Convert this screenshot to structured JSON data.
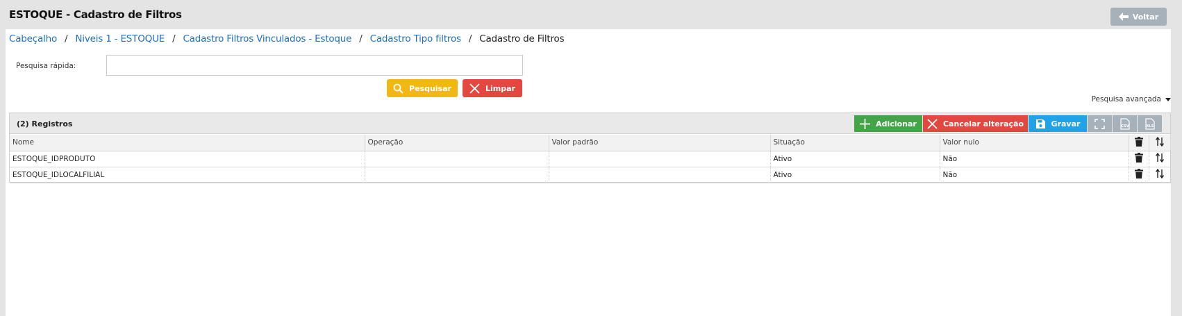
{
  "header": {
    "title": "ESTOQUE - Cadastro de Filtros",
    "back_label": "Voltar"
  },
  "breadcrumb": {
    "items": [
      "Cabeçalho",
      "Niveis 1 - ESTOQUE",
      "Cadastro Filtros Vinculados - Estoque",
      "Cadastro Tipo filtros"
    ],
    "current": "Cadastro de Filtros"
  },
  "search": {
    "label": "Pesquisa rápida:",
    "value": "",
    "search_label": "Pesquisar",
    "clear_label": "Limpar",
    "advanced_label": "Pesquisa avançada"
  },
  "grid": {
    "records_label": "(2) Registros",
    "toolbar": {
      "add_label": "Adicionar",
      "cancel_label": "Cancelar alteração",
      "save_label": "Gravar"
    },
    "columns": [
      "Nome",
      "Operação",
      "Valor padrão",
      "Situação",
      "Valor nulo"
    ],
    "rows": [
      {
        "nome": "ESTOQUE_IDPRODUTO",
        "operacao": "",
        "valor_padrao": "",
        "situacao": "Ativo",
        "valor_nulo": "Não"
      },
      {
        "nome": "ESTOQUE_IDLOCALFILIAL",
        "operacao": "",
        "valor_padrao": "",
        "situacao": "Ativo",
        "valor_nulo": "Não"
      }
    ]
  },
  "colors": {
    "add": "#43a547",
    "cancel": "#e2483f",
    "save": "#1fa3e6",
    "search": "#f2b714",
    "neutral": "#a6b1ba",
    "link": "#1f6fbf"
  },
  "icons": [
    "arrow-left-icon",
    "search-icon",
    "close-icon",
    "plus-icon",
    "save-icon",
    "fullscreen-icon",
    "csv-icon",
    "xls-icon",
    "trash-icon",
    "sort-icon",
    "caret-down-icon"
  ]
}
